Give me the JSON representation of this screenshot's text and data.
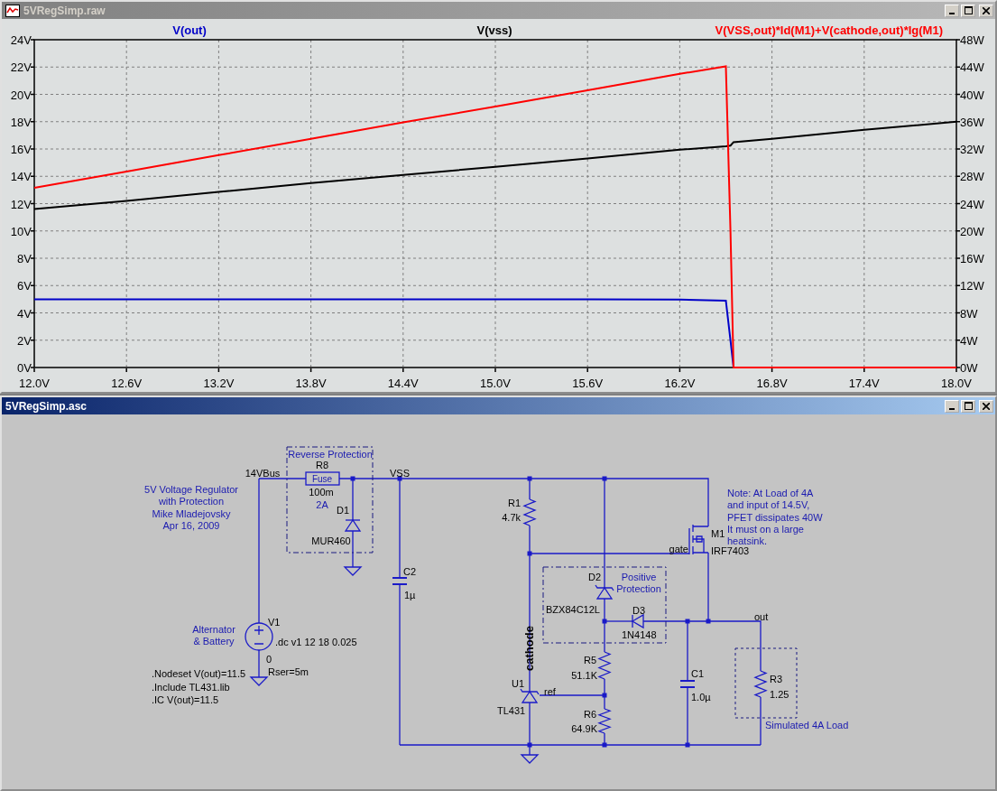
{
  "plot_window": {
    "title": "5VRegSimp.raw",
    "chart_data": {
      "type": "line",
      "grid": true,
      "x": [
        12.0,
        12.6,
        13.2,
        13.8,
        14.4,
        15.0,
        15.6,
        16.2,
        16.5,
        16.53,
        16.55,
        16.8,
        17.4,
        18.0
      ],
      "xlim": [
        12,
        18
      ],
      "ylim": [
        0,
        24
      ],
      "y2lim": [
        0,
        48
      ],
      "xticks": [
        {
          "value": 12.0,
          "label": "12.0V"
        },
        {
          "value": 12.6,
          "label": "12.6V"
        },
        {
          "value": 13.2,
          "label": "13.2V"
        },
        {
          "value": 13.8,
          "label": "13.8V"
        },
        {
          "value": 14.4,
          "label": "14.4V"
        },
        {
          "value": 15.0,
          "label": "15.0V"
        },
        {
          "value": 15.6,
          "label": "15.6V"
        },
        {
          "value": 16.2,
          "label": "16.2V"
        },
        {
          "value": 16.8,
          "label": "16.8V"
        },
        {
          "value": 17.4,
          "label": "17.4V"
        },
        {
          "value": 18.0,
          "label": "18.0V"
        }
      ],
      "yticks": [
        {
          "value": 0,
          "label": "0V"
        },
        {
          "value": 2,
          "label": "2V"
        },
        {
          "value": 4,
          "label": "4V"
        },
        {
          "value": 6,
          "label": "6V"
        },
        {
          "value": 8,
          "label": "8V"
        },
        {
          "value": 10,
          "label": "10V"
        },
        {
          "value": 12,
          "label": "12V"
        },
        {
          "value": 14,
          "label": "14V"
        },
        {
          "value": 16,
          "label": "16V"
        },
        {
          "value": 18,
          "label": "18V"
        },
        {
          "value": 20,
          "label": "20V"
        },
        {
          "value": 22,
          "label": "22V"
        },
        {
          "value": 24,
          "label": "24V"
        }
      ],
      "y2ticks": [
        {
          "value": 0,
          "label": "0W"
        },
        {
          "value": 4,
          "label": "4W"
        },
        {
          "value": 8,
          "label": "8W"
        },
        {
          "value": 12,
          "label": "12W"
        },
        {
          "value": 16,
          "label": "16W"
        },
        {
          "value": 20,
          "label": "20W"
        },
        {
          "value": 24,
          "label": "24W"
        },
        {
          "value": 28,
          "label": "28W"
        },
        {
          "value": 32,
          "label": "32W"
        },
        {
          "value": 36,
          "label": "36W"
        },
        {
          "value": 40,
          "label": "40W"
        },
        {
          "value": 44,
          "label": "44W"
        },
        {
          "value": 48,
          "label": "48W"
        }
      ],
      "series": [
        {
          "name": "V(out)",
          "color": "#0000c8",
          "values": [
            5.0,
            5.0,
            5.0,
            5.0,
            5.0,
            5.0,
            5.0,
            4.98,
            4.9,
            2.0,
            0,
            null,
            null,
            null
          ]
        },
        {
          "name": "V(vss)",
          "color": "#000000",
          "values": [
            11.6,
            12.2,
            12.85,
            13.5,
            14.1,
            14.7,
            15.3,
            15.95,
            16.2,
            16.25,
            16.5,
            16.75,
            17.4,
            18.0
          ]
        },
        {
          "name": "V(VSS,out)*Id(M1)+V(cathode,out)*Ig(M1)",
          "color": "#ff0000",
          "axis": "y2",
          "values": [
            26.3,
            28.7,
            31.1,
            33.5,
            35.9,
            38.2,
            40.6,
            43.0,
            44.1,
            20.0,
            0,
            0,
            0,
            0
          ]
        }
      ]
    }
  },
  "schematic_window": {
    "title": "5VRegSimp.asc",
    "labels": [
      {
        "kind": "comment",
        "text": "Reverse Protection"
      },
      {
        "kind": "part",
        "text": "R8"
      },
      {
        "kind": "net",
        "text": "14VBus"
      },
      {
        "kind": "net",
        "text": "VSS"
      },
      {
        "kind": "symbol",
        "text": "Fuse"
      },
      {
        "kind": "comment",
        "lines": [
          "5V Voltage Regulator",
          "with Protection",
          "Mike Mladejovsky",
          "Apr 16, 2009"
        ]
      },
      {
        "kind": "part",
        "text": "100m"
      },
      {
        "kind": "comment",
        "text": "2A"
      },
      {
        "kind": "part",
        "text": "D1"
      },
      {
        "kind": "part",
        "text": "MUR460"
      },
      {
        "kind": "comment",
        "lines": [
          "Note: At Load of 4A",
          "and input of 14.5V,",
          "PFET dissipates 40W",
          "It must on a large",
          "heatsink."
        ]
      },
      {
        "kind": "part",
        "text": "R1"
      },
      {
        "kind": "part",
        "text": "4.7k"
      },
      {
        "kind": "part",
        "text": "M1"
      },
      {
        "kind": "net",
        "text": "gate"
      },
      {
        "kind": "part",
        "text": "IRF7403"
      },
      {
        "kind": "part",
        "text": "C2"
      },
      {
        "kind": "part",
        "text": "1µ"
      },
      {
        "kind": "part",
        "text": "D2"
      },
      {
        "kind": "comment",
        "lines": [
          "Positive",
          "Protection"
        ]
      },
      {
        "kind": "part",
        "text": "BZX84C12L"
      },
      {
        "kind": "part",
        "text": "D3"
      },
      {
        "kind": "part",
        "text": "V1"
      },
      {
        "kind": "net",
        "text": "out"
      },
      {
        "kind": "comment",
        "lines": [
          "Alternator",
          "& Battery"
        ]
      },
      {
        "kind": "part",
        "text": "1N4148"
      },
      {
        "kind": "directive",
        "text": ".dc v1 12 18 0.025"
      },
      {
        "kind": "net-vertical",
        "text": "cathode"
      },
      {
        "kind": "part",
        "text": "0"
      },
      {
        "kind": "directive",
        "text": ".Nodeset V(out)=11.5"
      },
      {
        "kind": "part",
        "text": "Rser=5m"
      },
      {
        "kind": "part",
        "text": "R5"
      },
      {
        "kind": "part",
        "text": "R3"
      },
      {
        "kind": "part",
        "text": "C1"
      },
      {
        "kind": "part",
        "text": "U1"
      },
      {
        "kind": "part",
        "text": "51.1K"
      },
      {
        "kind": "net",
        "text": "ref"
      },
      {
        "kind": "directive",
        "text": ".Include TL431.lib"
      },
      {
        "kind": "part",
        "text": "1.0µ"
      },
      {
        "kind": "part",
        "text": "1.25"
      },
      {
        "kind": "directive",
        "text": ".IC  V(out)=11.5"
      },
      {
        "kind": "part",
        "text": "TL431"
      },
      {
        "kind": "part",
        "text": "R6"
      },
      {
        "kind": "comment",
        "text": "Simulated 4A Load"
      },
      {
        "kind": "part",
        "text": "64.9K"
      }
    ]
  }
}
